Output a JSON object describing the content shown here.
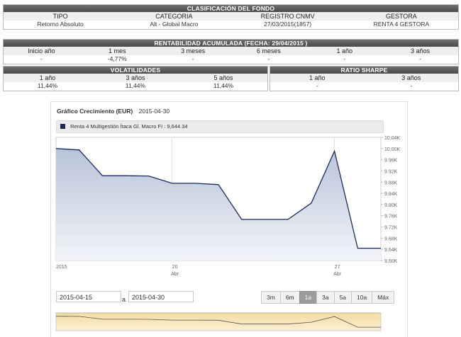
{
  "clasificacion": {
    "title": "CLASIFICACIÓN DEL FONDO",
    "headers": [
      "TIPO",
      "CATEGORIA",
      "REGISTRO CNMV",
      "GESTORA"
    ],
    "values": [
      "Retorno Absoluto",
      "Alt - Global Macro",
      "27/03/2015(1857)",
      "RENTA 4 GESTORA"
    ]
  },
  "rentabilidad": {
    "title": "RENTABILIDAD ACUMULADA (FECHA: 29/04/2015 )",
    "headers": [
      "Inicio año",
      "1 mes",
      "3 meses",
      "6 meses",
      "1 año",
      "3 años"
    ],
    "values": [
      "-",
      "-4,77%",
      "-",
      "-",
      "-",
      "-"
    ]
  },
  "volatilidades": {
    "title": "VOLATILIDADES",
    "headers": [
      "1 año",
      "3 años",
      "5 años"
    ],
    "values": [
      "11,44%",
      "11,44%",
      "11,44%"
    ]
  },
  "sharpe": {
    "title": "RATIO SHARPE",
    "headers": [
      "1 año",
      "3 años"
    ],
    "values": [
      "-",
      "-"
    ]
  },
  "chart": {
    "title": "Gráfico Crecimiento (EUR)",
    "date": "2015-04-30",
    "legend": "Renta 4 Multigestión Ítaca Gl. Macro FI : 9,644.34",
    "from_date": "2015-04-15",
    "separator": "a",
    "to_date": "2015-04-30",
    "range_buttons": [
      "3m",
      "6m",
      "1a",
      "3a",
      "5a",
      "10a",
      "Máx"
    ],
    "active_range": "1a",
    "series_color": "#1b2a5e"
  },
  "chart_data": {
    "type": "area",
    "series": [
      {
        "name": "Renta 4 Multigestión Ítaca Gl. Macro FI",
        "values": [
          10000,
          9995,
          9903,
          9903,
          9902,
          9876,
          9876,
          9871,
          9747,
          9747,
          9747,
          9805,
          9991,
          9644,
          9644
        ]
      }
    ],
    "x_ticks": [
      {
        "index": 0,
        "label": "2015",
        "sub": ""
      },
      {
        "index": 5,
        "label": "20",
        "sub": "Abr"
      },
      {
        "index": 12,
        "label": "27",
        "sub": "Abr"
      }
    ],
    "y_ticks": [
      "9.60K",
      "9.64K",
      "9.68K",
      "9.72K",
      "9.76K",
      "9.80K",
      "9.84K",
      "9.88K",
      "9.92K",
      "9.96K",
      "10.00K",
      "10.04K"
    ],
    "ylim": [
      9600,
      10040
    ],
    "grid": "vertical"
  }
}
